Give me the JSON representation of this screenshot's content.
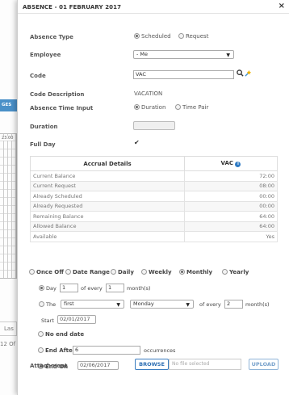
{
  "background": {
    "button_label": "GES",
    "time_label": "23:00",
    "last_label": "Las",
    "status_text": "12 Of"
  },
  "modal": {
    "title": "ABSENCE - 01 FEBRUARY 2017",
    "close": "×"
  },
  "form": {
    "absence_type": {
      "label": "Absence Type",
      "options": [
        "Scheduled",
        "Request"
      ],
      "selected": "Scheduled"
    },
    "employee": {
      "label": "Employee",
      "value": "- Me"
    },
    "code": {
      "label": "Code",
      "value": "VAC"
    },
    "code_description": {
      "label": "Code Description",
      "value": "VACATION"
    },
    "time_input": {
      "label": "Absence Time Input",
      "options": [
        "Duration",
        "Time Pair"
      ],
      "selected": "Duration"
    },
    "duration": {
      "label": "Duration",
      "value": ""
    },
    "full_day": {
      "label": "Full Day",
      "checked": "✔"
    }
  },
  "accrual": {
    "header_left": "Accrual Details",
    "header_right": "VAC",
    "info_glyph": "i",
    "rows": [
      {
        "name": "Current Balance",
        "value": "72:00"
      },
      {
        "name": "Current Request",
        "value": "08:00"
      },
      {
        "name": "Already Scheduled",
        "value": "00:00"
      },
      {
        "name": "Already Requested",
        "value": "00:00"
      },
      {
        "name": "Remaining Balance",
        "value": "64:00"
      },
      {
        "name": "Allowed Balance",
        "value": "64:00"
      },
      {
        "name": "Available",
        "value": "Yes"
      }
    ]
  },
  "recurrence": {
    "options": [
      "Once Off",
      "Date Range",
      "Daily",
      "Weekly",
      "Monthly",
      "Yearly"
    ],
    "selected": "Monthly",
    "day_option": {
      "prefix": "Day",
      "day": "1",
      "middle": "of every",
      "every": "1",
      "suffix": "month(s)"
    },
    "the_option": {
      "prefix": "The",
      "ordinal": "first",
      "weekday": "Monday",
      "middle": "of every",
      "every": "2",
      "suffix": "month(s)"
    },
    "start": {
      "label": "Start",
      "value": "02/01/2017"
    },
    "no_end": "No end date",
    "end_after": {
      "label": "End After",
      "value": "6",
      "suffix": "occurrences"
    },
    "end_on": {
      "label": "End On",
      "value": "02/06/2017"
    }
  },
  "attachment": {
    "label": "Attachment",
    "browse": "BROWSE",
    "placeholder": "No file selected",
    "upload": "UPLOAD"
  }
}
